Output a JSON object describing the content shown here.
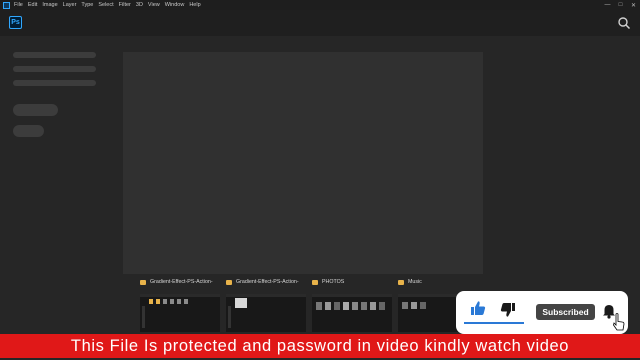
{
  "menu": {
    "items": [
      "File",
      "Edit",
      "Image",
      "Layer",
      "Type",
      "Select",
      "Filter",
      "3D",
      "View",
      "Window",
      "Help"
    ]
  },
  "header": {
    "logo_text": "Ps"
  },
  "recent_files": [
    {
      "name": "Gradient-Effect-PS-Action-"
    },
    {
      "name": "Gradient-Effect-PS-Action-"
    },
    {
      "name": "PHOTOS"
    },
    {
      "name": "Music"
    }
  ],
  "overlay": {
    "subscribe_label": "Subscribed"
  },
  "banner": {
    "text": "This File Is protected and password in video kindly watch video"
  },
  "colors": {
    "accent_blue": "#31a8ff",
    "banner_red": "#e01818",
    "like_blue": "#2a79d6"
  },
  "icons": [
    "ps-icon",
    "search-icon",
    "folder-icon",
    "thumbs-up-icon",
    "thumbs-down-icon",
    "bell-icon",
    "cursor-icon"
  ]
}
